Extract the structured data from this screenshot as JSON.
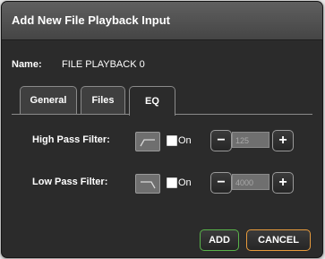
{
  "dialog": {
    "title": "Add New File Playback Input"
  },
  "name": {
    "label": "Name:",
    "value": "FILE PLAYBACK 0"
  },
  "tabs": [
    {
      "label": "General",
      "active": false
    },
    {
      "label": "Files",
      "active": false
    },
    {
      "label": "EQ",
      "active": true
    }
  ],
  "eq": {
    "high_pass": {
      "label": "High Pass Filter:",
      "icon": "high-pass-filter-icon",
      "on_checked": false,
      "on_label": "On",
      "value": "125",
      "minus": "−",
      "plus": "+"
    },
    "low_pass": {
      "label": "Low Pass Filter:",
      "icon": "low-pass-filter-icon",
      "on_checked": false,
      "on_label": "On",
      "value": "4000",
      "minus": "−",
      "plus": "+"
    }
  },
  "footer": {
    "add_label": "ADD",
    "cancel_label": "CANCEL"
  },
  "colors": {
    "add_border": "#59b34a",
    "cancel_border": "#e89b3c"
  }
}
